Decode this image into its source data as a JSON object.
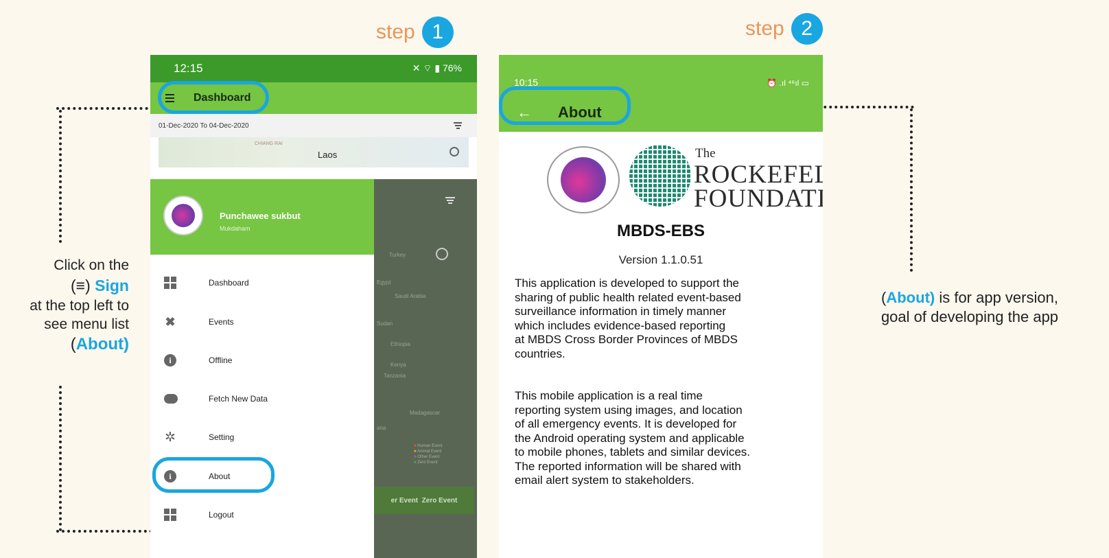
{
  "steps": [
    {
      "label": "step",
      "number": "1"
    },
    {
      "label": "step",
      "number": "2"
    }
  ],
  "left_note": {
    "line1": "Click on the",
    "line2_open": "(",
    "line2_icon": "≡",
    "line2_close": ")",
    "line2_bold": "Sign",
    "line3": "at the top left to",
    "line4": "see menu list",
    "line5_open": "(",
    "line5_bold": "About)"
  },
  "right_note": {
    "open": "(",
    "bold": "About)",
    "rest": " is for app version,",
    "line2": "goal of developing the app"
  },
  "phone1": {
    "status_time": "12:15",
    "status_icons": "✕ ⌔ ▮ 76%",
    "appbar_title": "Dashboard",
    "date_range": "01-Dec-2020 To 04-Dec-2020",
    "map_label_laos": "Laos",
    "map_label_city": "CHIANG RAI",
    "drawer": {
      "user_name": "Punchawee sukbut",
      "user_location": "Mukdaham",
      "menu": [
        {
          "label": "Dashboard",
          "icon": "dashboard-icon"
        },
        {
          "label": "Events",
          "icon": "events-icon"
        },
        {
          "label": "Offline",
          "icon": "info-icon"
        },
        {
          "label": "Fetch New Data",
          "icon": "cloud-download-icon"
        },
        {
          "label": "Setting",
          "icon": "gear-icon"
        },
        {
          "label": "About",
          "icon": "info-icon"
        },
        {
          "label": "Logout",
          "icon": "logout-icon"
        }
      ]
    },
    "background_map_labels": [
      "Turkey",
      "Egypt",
      "Saudi Arabia",
      "Sudan",
      "Ethiopia",
      "Kenya",
      "Tanzania",
      "Madagascar",
      "ana"
    ],
    "background_legend": [
      "Human Event",
      "Animal Event",
      "Other Event",
      "Zero Event"
    ],
    "background_tabs": "er Event  Zero Event"
  },
  "phone2": {
    "status_time": "10:15",
    "status_icons": "⏰ .ıl ⁴⁶ıl ▭",
    "appbar_title": "About",
    "back_icon": "←",
    "logo_the": "The",
    "logo_line1": "ROCKEFELLER",
    "logo_line2": "FOUNDATION",
    "app_name": "MBDS-EBS",
    "version": "Version 1.1.0.51",
    "paragraph1": "This application is developed to support the\nsharing of public health related event-based\nsurveillance information in timely manner\nwhich includes evidence-based reporting\nat MBDS Cross Border Provinces of MBDS\ncountries.",
    "paragraph2": " This mobile application is a real time\nreporting system using images, and location\nof all emergency events. It is developed for\nthe Android operating system and applicable\nto mobile phones, tablets and similar devices.\nThe reported information will be shared with\nemail alert system to stakeholders."
  },
  "colors": {
    "accent_blue": "#1aa6e0",
    "step_orange": "#e8955a",
    "app_green": "#76c543",
    "status_green": "#3b9a2a",
    "background": "#fdf8ee"
  }
}
